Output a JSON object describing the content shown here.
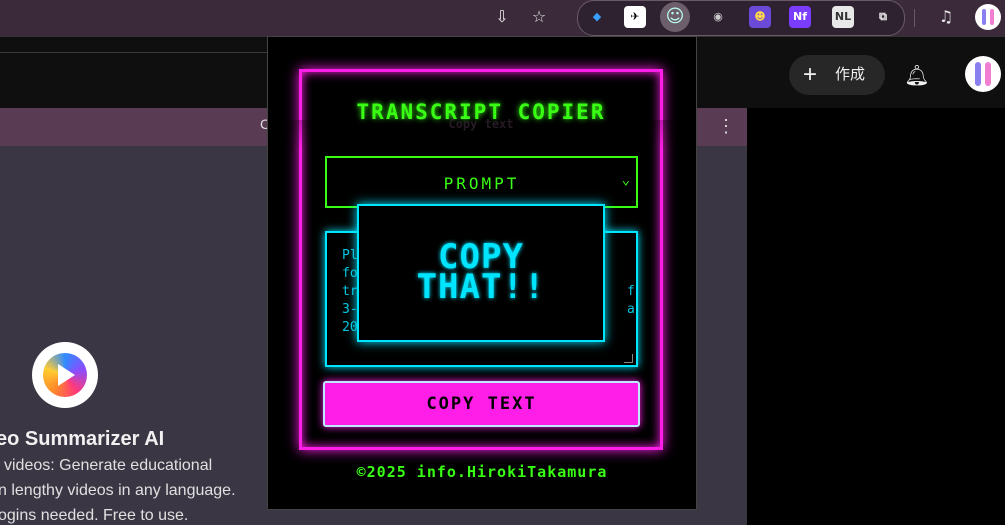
{
  "browser": {
    "toolbar_icons": [
      "install-app-icon",
      "star-icon"
    ],
    "extensions": [
      {
        "name": "gem-extension-icon",
        "glyph": "◆",
        "bg": "#2f2230",
        "color": "#3aa0ff"
      },
      {
        "name": "telegram-extension-icon",
        "glyph": "✈",
        "bg": "#ffffff",
        "color": "#000"
      },
      {
        "name": "transcript-copier-extension-icon",
        "glyph": "☺",
        "bg": "#6d5e6c",
        "color": "#bfe"
      },
      {
        "name": "camera-extension-icon",
        "glyph": "◉",
        "bg": "#2f2230",
        "color": "#ccc"
      },
      {
        "name": "people-extension-icon",
        "glyph": "☻",
        "bg": "#6b4ad8",
        "color": "#ffd54a"
      },
      {
        "name": "nf-extension-icon",
        "glyph": "Nf",
        "bg": "#7a3cff",
        "color": "#fff"
      },
      {
        "name": "nl-extension-icon",
        "glyph": "NL",
        "bg": "#e8e8e8",
        "color": "#333"
      },
      {
        "name": "extensions-puzzle-icon",
        "glyph": "⧉",
        "bg": "#2f2230",
        "color": "#eee"
      }
    ],
    "media_icon": "♫"
  },
  "page": {
    "create_label": "作成",
    "panel_letter": "C",
    "app_title": "eo Summarizer AI",
    "app_desc": [
      "videos: Generate educational",
      "n lengthy videos in any language.",
      "ogins needed. Free to use."
    ]
  },
  "popup": {
    "title": "TRANSCRIPT COPIER",
    "title_echo": "Copy text",
    "select_value": "PROMPT",
    "textarea_lines": [
      "Pl",
      "fo",
      "tr",
      "3-",
      "20"
    ],
    "textarea_right": [
      "",
      "",
      "f",
      "a",
      ""
    ],
    "overlay_line1": "COPY",
    "overlay_line2": "THAT!!",
    "copy_button": "COPY TEXT",
    "footer": "©2025 info.HirokiTakamura"
  },
  "colors": {
    "neon_green": "#39ff14",
    "neon_pink": "#ff1ee8",
    "neon_cyan": "#00e5ff"
  }
}
